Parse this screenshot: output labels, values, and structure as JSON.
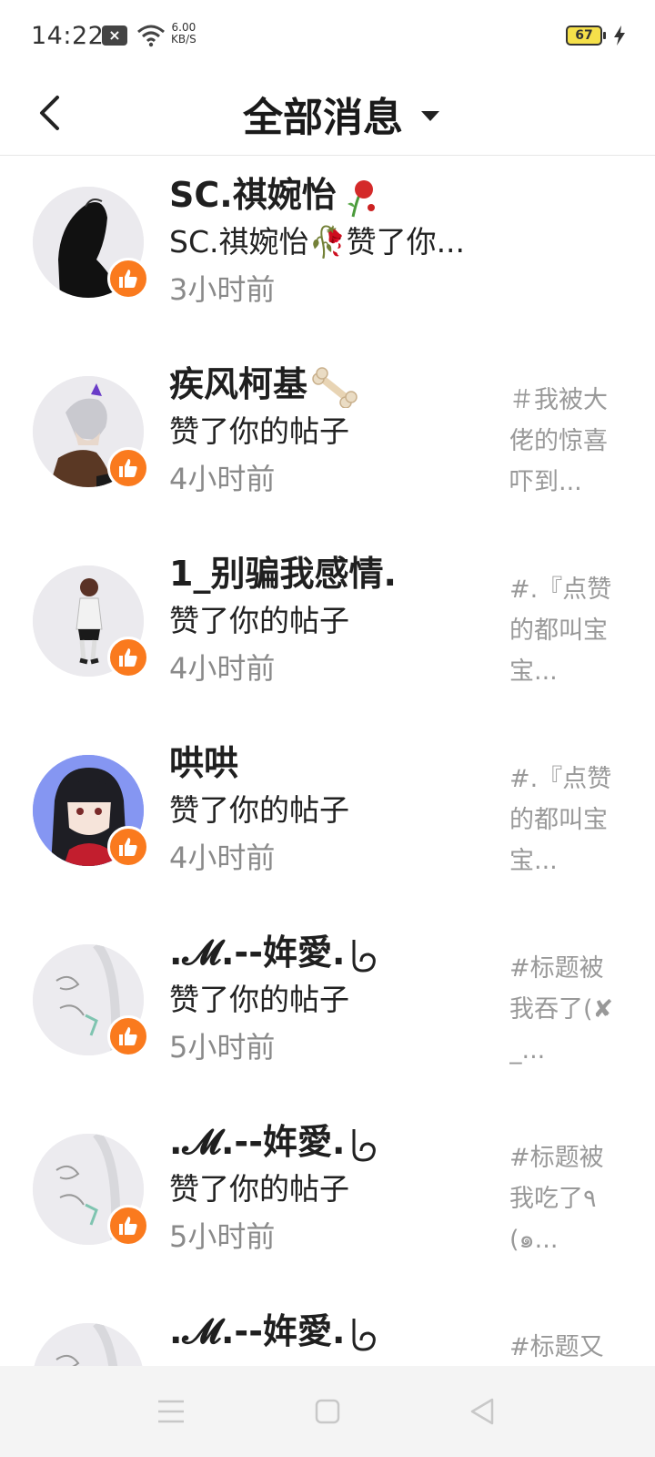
{
  "status_bar": {
    "time": "14:22",
    "net_speed_value": "6.00",
    "net_speed_unit": "KB/S",
    "battery": "67"
  },
  "header": {
    "title": "全部消息"
  },
  "messages": [
    {
      "name": "SC.祺婉怡",
      "name_emoji": "rose-icon",
      "action": "SC.祺婉怡🥀赞了你...",
      "time": "3小时前",
      "post": ""
    },
    {
      "name": "疾风柯基",
      "name_emoji": "bone-icon",
      "action": "赞了你的帖子",
      "time": "4小时前",
      "post": "＃我被大佬的惊喜吓到..."
    },
    {
      "name": "1_别骗我感情.",
      "action": "赞了你的帖子",
      "time": "4小时前",
      "post": "#.『点赞的都叫宝宝..."
    },
    {
      "name": "哄哄",
      "action": "赞了你的帖子",
      "time": "4小时前",
      "post": "#.『点赞的都叫宝宝..."
    },
    {
      "name": ".𝓜.--姩愛.",
      "action": "赞了你的帖子",
      "time": "5小时前",
      "post": "#标题被我吞了(✘_..."
    },
    {
      "name": ".𝓜.--姩愛.",
      "action": "赞了你的帖子",
      "time": "5小时前",
      "post": "#标题被我吃了٩(๑..."
    },
    {
      "name": ".𝓜.--姩愛.",
      "action": "",
      "time": "",
      "post": "#标题又"
    }
  ],
  "colors": {
    "like_badge": "#fa7a1e",
    "secondary_text": "#8a8a8a",
    "post_text": "#999999"
  }
}
